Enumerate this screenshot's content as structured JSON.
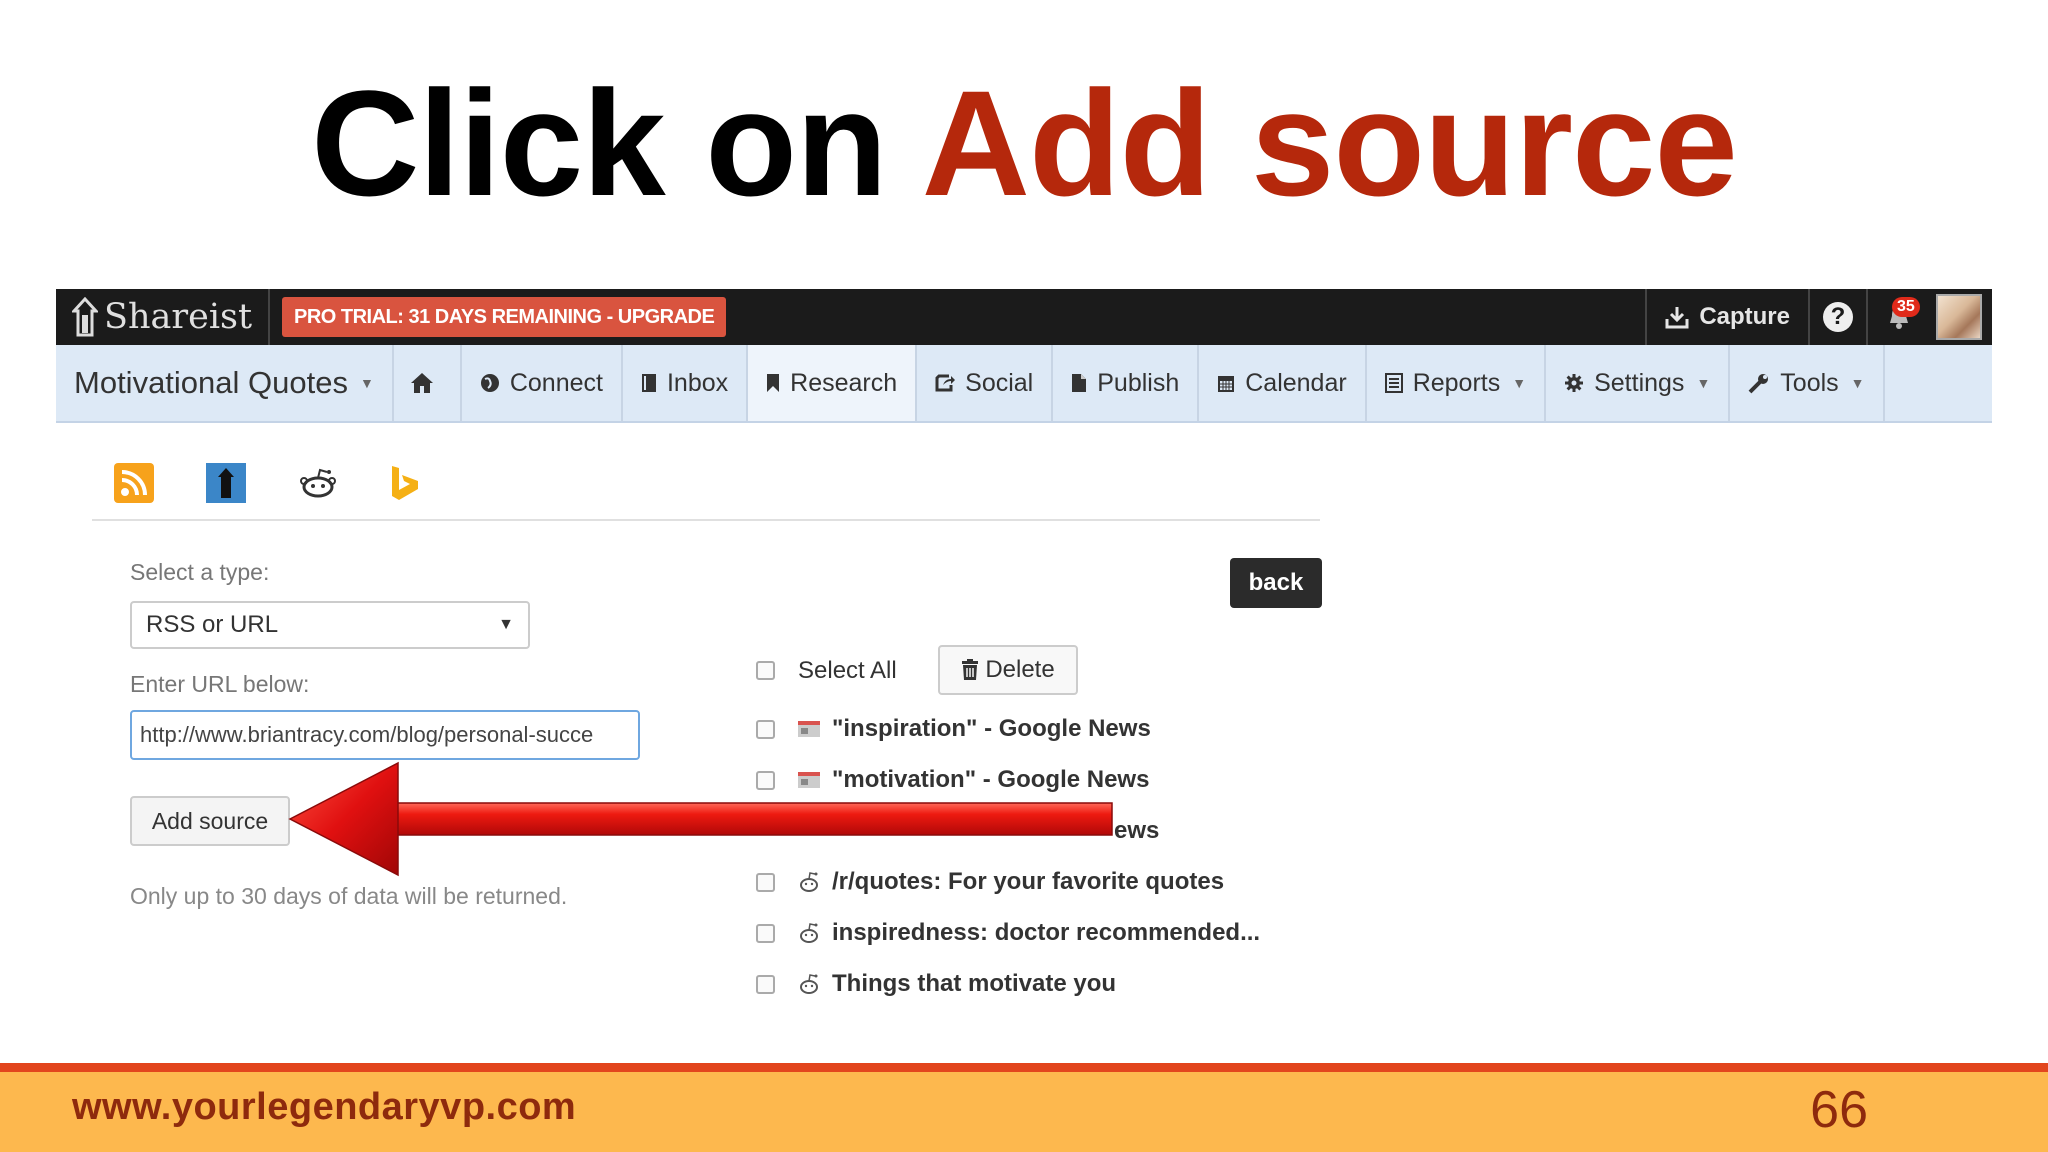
{
  "slide": {
    "title_prefix": "Click on ",
    "title_accent": "Add source",
    "footer_url": "www.yourlegendaryvp.com",
    "page_number": "66"
  },
  "colors": {
    "accent": "#b5280c",
    "footer_bg": "#fdb84e",
    "footer_line": "#e2451d",
    "topbar_bg": "#1b1b1b",
    "navbar_bg": "#dde9f6",
    "pro_trial_bg": "#d9543f",
    "arrow": "#e01010"
  },
  "topbar": {
    "brand": "Shareist",
    "pro_trial": "PRO TRIAL: 31 DAYS REMAINING - UPGRADE",
    "capture_label": "Capture",
    "help_label": "?",
    "notifications_count": "35"
  },
  "navbar": {
    "project": "Motivational Quotes",
    "items": [
      {
        "label": "Connect",
        "icon": "globe-icon"
      },
      {
        "label": "Inbox",
        "icon": "inbox-icon"
      },
      {
        "label": "Research",
        "icon": "bookmark-icon"
      },
      {
        "label": "Social",
        "icon": "share-icon"
      },
      {
        "label": "Publish",
        "icon": "file-icon"
      },
      {
        "label": "Calendar",
        "icon": "calendar-icon"
      },
      {
        "label": "Reports",
        "icon": "list-icon"
      },
      {
        "label": "Settings",
        "icon": "gear-icon"
      },
      {
        "label": "Tools",
        "icon": "wrench-icon"
      }
    ]
  },
  "source_types": [
    "rss-icon",
    "shareist-icon",
    "reddit-icon",
    "bing-icon"
  ],
  "form": {
    "type_label": "Select a type:",
    "type_value": "RSS or URL",
    "url_label": "Enter URL below:",
    "url_value": "http://www.briantracy.com/blog/personal-succe",
    "add_button": "Add source",
    "note": "Only up to 30 days of data will be returned."
  },
  "sources": {
    "back_button": "back",
    "select_all": "Select All",
    "delete_button": "Delete",
    "items": [
      {
        "label": "\"inspiration\" - Google News",
        "icon": "news-icon"
      },
      {
        "label": "\"motivation\" - Google News",
        "icon": "news-icon"
      },
      {
        "label": "ews",
        "icon": "news-icon"
      },
      {
        "label": "/r/quotes: For your favorite quotes",
        "icon": "reddit-icon"
      },
      {
        "label": "inspiredness: doctor recommended...",
        "icon": "reddit-icon"
      },
      {
        "label": "Things that motivate you",
        "icon": "reddit-icon"
      }
    ]
  }
}
